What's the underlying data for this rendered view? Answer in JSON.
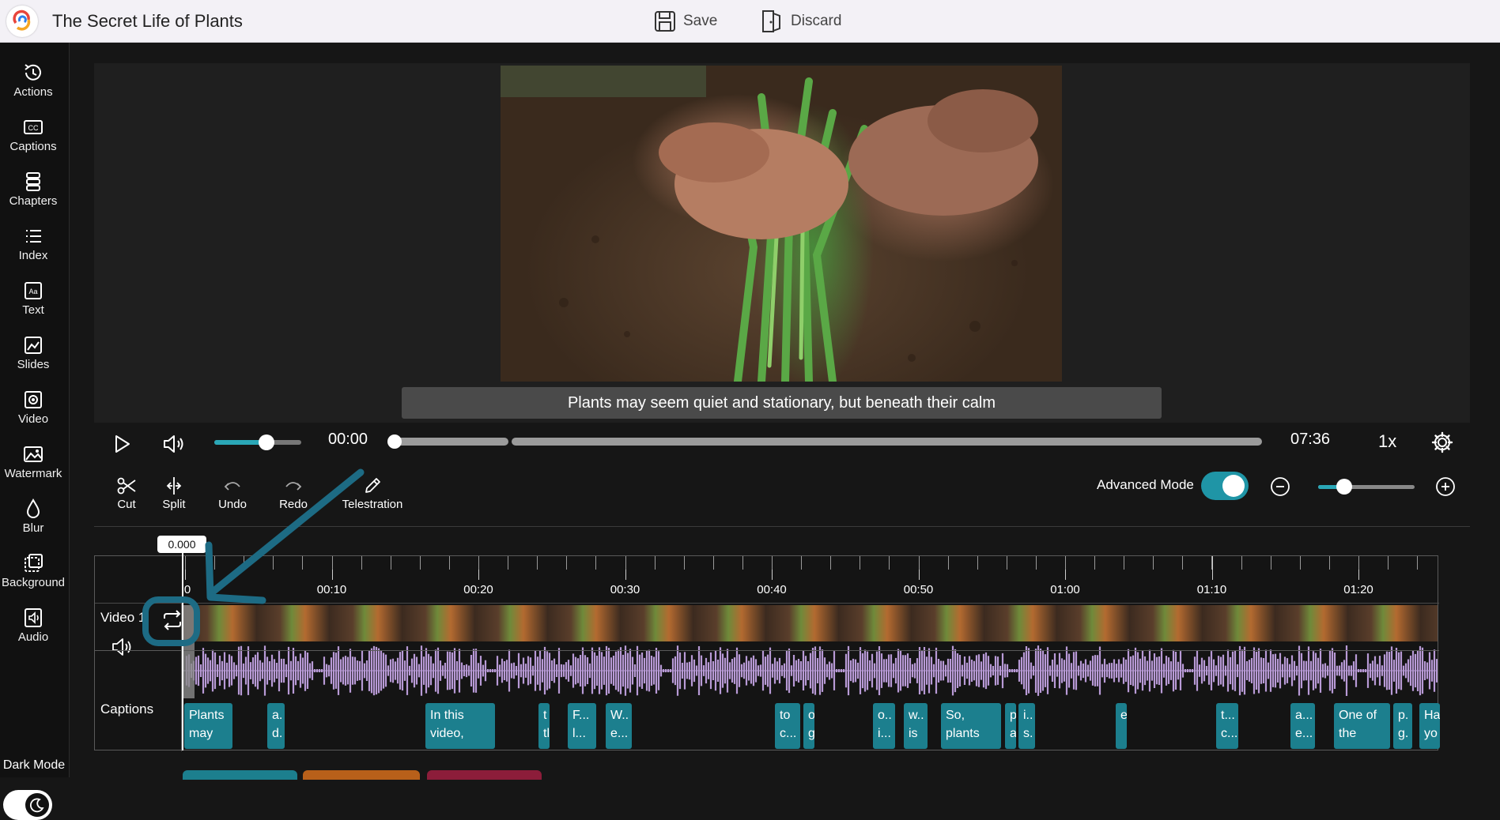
{
  "header": {
    "title": "The Secret Life of Plants",
    "save_label": "Save",
    "discard_label": "Discard"
  },
  "sidebar": {
    "items": [
      {
        "label": "Actions",
        "icon": "history-icon"
      },
      {
        "label": "Captions",
        "icon": "cc-icon"
      },
      {
        "label": "Chapters",
        "icon": "chapters-icon"
      },
      {
        "label": "Index",
        "icon": "list-icon"
      },
      {
        "label": "Text",
        "icon": "text-icon"
      },
      {
        "label": "Slides",
        "icon": "slides-icon"
      },
      {
        "label": "Video",
        "icon": "video-icon"
      },
      {
        "label": "Watermark",
        "icon": "watermark-icon"
      },
      {
        "label": "Blur",
        "icon": "droplet-icon"
      },
      {
        "label": "Background",
        "icon": "background-icon"
      },
      {
        "label": "Audio",
        "icon": "audio-file-icon"
      }
    ],
    "dark_mode_label": "Dark Mode",
    "dark_mode_on": true
  },
  "player": {
    "subtitle": "Plants may seem quiet and stationary, but beneath their calm",
    "current_time": "00:00",
    "total_time": "07:36",
    "speed": "1x",
    "volume_fraction": 0.6,
    "progress_fraction": 0.0
  },
  "tools": {
    "cut": "Cut",
    "split": "Split",
    "undo": "Undo",
    "redo": "Redo",
    "telestration": "Telestration"
  },
  "advanced": {
    "label": "Advanced Mode",
    "on": true,
    "zoom_fraction": 0.27
  },
  "timeline": {
    "playhead_value": "0.000",
    "ticks": [
      "0",
      "00:10",
      "00:20",
      "00:30",
      "00:40",
      "00:50",
      "01:00",
      "01:10",
      "01:20"
    ],
    "video_track_label": "Video 1",
    "captions_track_label": "Captions",
    "captions": [
      {
        "line1": "Plants",
        "line2": "may"
      },
      {
        "line1": "a.",
        "line2": "d."
      },
      {
        "line1": "In this",
        "line2": "video,"
      },
      {
        "line1": "t",
        "line2": "tl"
      },
      {
        "line1": "F...",
        "line2": "l..."
      },
      {
        "line1": "W..",
        "line2": "e..."
      },
      {
        "line1": "to",
        "line2": "c..."
      },
      {
        "line1": "o",
        "line2": "g"
      },
      {
        "line1": "o..",
        "line2": "i..."
      },
      {
        "line1": "w..",
        "line2": "is"
      },
      {
        "line1": "So,",
        "line2": "plants"
      },
      {
        "line1": "p",
        "line2": "a"
      },
      {
        "line1": "i..",
        "line2": "s."
      },
      {
        "line1": "e",
        "line2": ""
      },
      {
        "line1": "t...",
        "line2": "c..."
      },
      {
        "line1": "a...",
        "line2": "e..."
      },
      {
        "line1": "One of",
        "line2": "the"
      },
      {
        "line1": "p.",
        "line2": "g."
      },
      {
        "line1": "Ha",
        "line2": "yo"
      }
    ]
  },
  "colors": {
    "accent": "#1f95a6",
    "caption_chip": "#1c7f8e",
    "waveform": "#b89ad6",
    "annotation": "#1d6b84"
  }
}
